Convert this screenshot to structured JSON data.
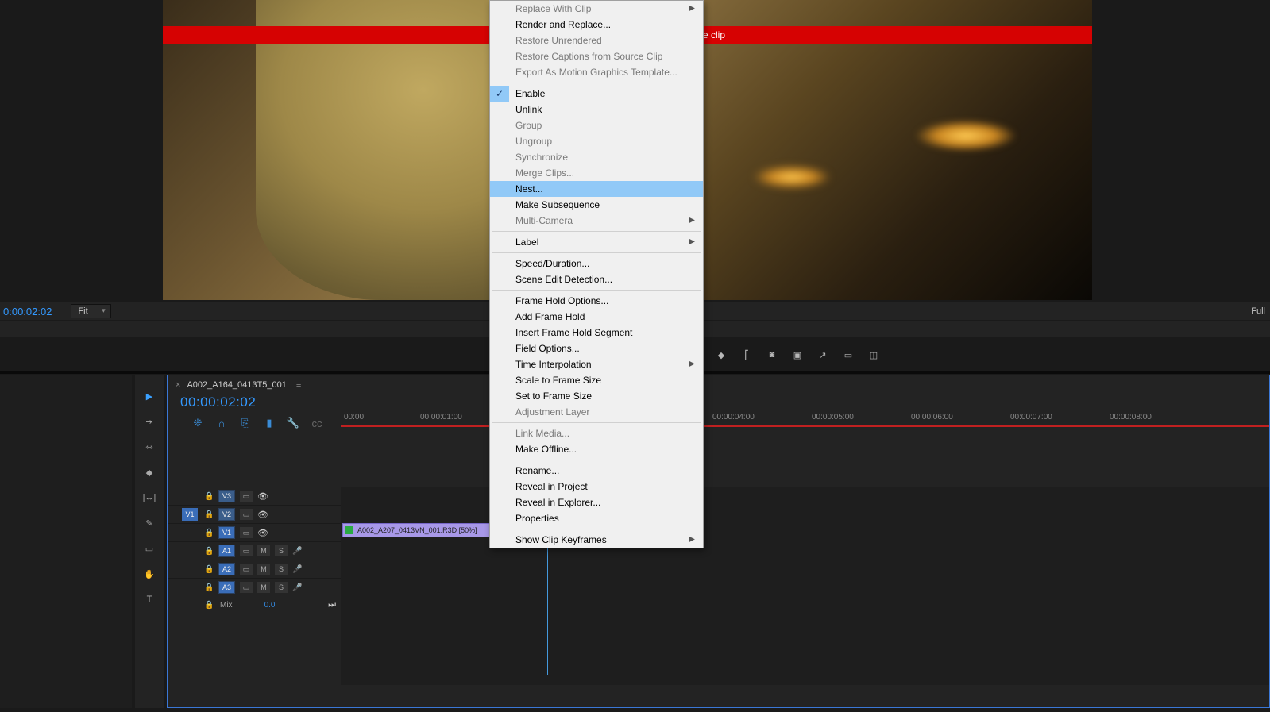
{
  "programMonitor": {
    "redBannerSuffix": "me clip"
  },
  "playbar": {
    "timecode": "0:00:02:02",
    "fitLabel": "Fit",
    "fullLabel": "Full"
  },
  "timeline": {
    "sequenceName": "A002_A164_0413T5_001",
    "timecode": "00:00:02:02",
    "ruler": [
      "00:00",
      "00:00:01:00",
      "00:00:04:00",
      "00:00:05:00",
      "00:00:06:00",
      "00:00:07:00",
      "00:00:08:00"
    ],
    "tracks": {
      "v3": "V3",
      "v2": "V2",
      "v1": "V1",
      "a1": "A1",
      "a2": "A2",
      "a3": "A3",
      "m": "M",
      "s": "S",
      "mix": "Mix",
      "mixVal": "0.0",
      "v1tag": "V1"
    },
    "clipName": "A002_A207_0413VN_001.R3D [50%]"
  },
  "contextMenu": {
    "items": [
      {
        "label": "Replace With Clip",
        "disabled": true,
        "submenu": true,
        "sepAfter": false
      },
      {
        "label": "Render and Replace...",
        "disabled": false
      },
      {
        "label": "Restore Unrendered",
        "disabled": true
      },
      {
        "label": "Restore Captions from Source Clip",
        "disabled": true
      },
      {
        "label": "Export As Motion Graphics Template...",
        "disabled": true,
        "sepAfter": true
      },
      {
        "label": "Enable",
        "checked": true
      },
      {
        "label": "Unlink"
      },
      {
        "label": "Group",
        "disabled": true
      },
      {
        "label": "Ungroup",
        "disabled": true
      },
      {
        "label": "Synchronize",
        "disabled": true
      },
      {
        "label": "Merge Clips...",
        "disabled": true
      },
      {
        "label": "Nest...",
        "highlighted": true
      },
      {
        "label": "Make Subsequence"
      },
      {
        "label": "Multi-Camera",
        "disabled": true,
        "submenu": true,
        "sepAfter": true
      },
      {
        "label": "Label",
        "submenu": true,
        "sepAfter": true
      },
      {
        "label": "Speed/Duration..."
      },
      {
        "label": "Scene Edit Detection...",
        "sepAfter": true
      },
      {
        "label": "Frame Hold Options..."
      },
      {
        "label": "Add Frame Hold"
      },
      {
        "label": "Insert Frame Hold Segment"
      },
      {
        "label": "Field Options..."
      },
      {
        "label": "Time Interpolation",
        "submenu": true
      },
      {
        "label": "Scale to Frame Size"
      },
      {
        "label": "Set to Frame Size"
      },
      {
        "label": "Adjustment Layer",
        "disabled": true,
        "sepAfter": true
      },
      {
        "label": "Link Media...",
        "disabled": true
      },
      {
        "label": "Make Offline...",
        "sepAfter": true
      },
      {
        "label": "Rename..."
      },
      {
        "label": "Reveal in Project"
      },
      {
        "label": "Reveal in Explorer..."
      },
      {
        "label": "Properties",
        "sepAfter": true
      },
      {
        "label": "Show Clip Keyframes",
        "submenu": true
      }
    ]
  }
}
